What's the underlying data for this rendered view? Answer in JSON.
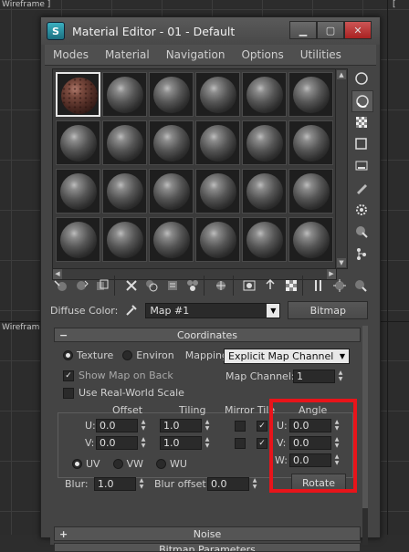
{
  "viewports": {
    "top_label": "Wireframe ]",
    "mid_label": "Wireframe",
    "right_mark": "["
  },
  "window": {
    "icon_letter": "S",
    "title": "Material Editor - 01 - Default",
    "min": "▁",
    "max": "▢",
    "close": "✕"
  },
  "menu": [
    "Modes",
    "Material",
    "Navigation",
    "Options",
    "Utilities"
  ],
  "slots": {
    "rows": 4,
    "cols": 6,
    "active_index": 0,
    "active_material": "brick"
  },
  "diffuse": {
    "label": "Diffuse Color:",
    "map_value": "Map #1",
    "map_type": "Bitmap"
  },
  "coordinates": {
    "title": "Coordinates",
    "mode_texture": "Texture",
    "mode_environ": "Environ",
    "mapping_label": "Mapping:",
    "mapping_value": "Explicit Map Channel",
    "show_map_on_back": "Show Map on Back",
    "map_channel_label": "Map Channel:",
    "map_channel_value": "1",
    "use_real_world": "Use Real-World Scale",
    "col_offset": "Offset",
    "col_tiling": "Tiling",
    "col_mirror_tile": "Mirror Tile",
    "col_angle": "Angle",
    "u_label": "U:",
    "v_label": "V:",
    "w_label": "W:",
    "u_offset": "0.0",
    "v_offset": "0.0",
    "u_tiling": "1.0",
    "v_tiling": "1.0",
    "u_angle": "0.0",
    "v_angle": "0.0",
    "w_angle": "0.0",
    "uv": "UV",
    "vw": "VW",
    "wu": "WU",
    "blur_label": "Blur:",
    "blur_value": "1.0",
    "blur_offset_label": "Blur offset:",
    "blur_offset_value": "0.0",
    "rotate_label": "Rotate"
  },
  "noise": {
    "title": "Noise"
  },
  "bitmap_params": {
    "title": "Bitmap Parameters"
  },
  "colors": {
    "highlight": "#e8141a",
    "active_slot_border": "#e6e6e6"
  }
}
